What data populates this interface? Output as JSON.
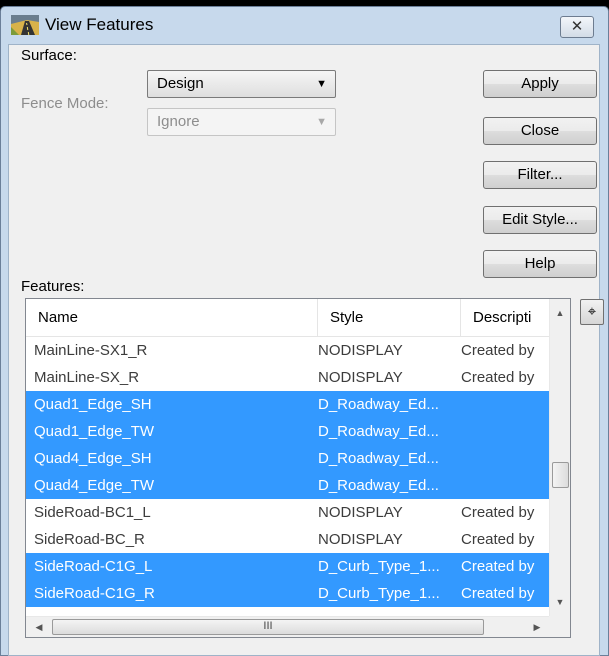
{
  "window": {
    "title": "View Features",
    "close_glyph": "✕"
  },
  "surface": {
    "label": "Surface:",
    "value": "Design"
  },
  "fence_mode": {
    "label": "Fence Mode:",
    "value": "Ignore"
  },
  "buttons": {
    "apply": "Apply",
    "close": "Close",
    "filter": "Filter...",
    "edit_style": "Edit Style...",
    "help": "Help"
  },
  "features": {
    "label": "Features:",
    "columns": [
      "Name",
      "Style",
      "Descripti"
    ],
    "rows": [
      {
        "name": "MainLine-SX1_R",
        "style": "NODISPLAY",
        "description": "Created by"
      },
      {
        "name": "MainLine-SX_R",
        "style": "NODISPLAY",
        "description": "Created by"
      },
      {
        "name": "Quad1_Edge_SH",
        "style": "D_Roadway_Ed...",
        "description": ""
      },
      {
        "name": "Quad1_Edge_TW",
        "style": "D_Roadway_Ed...",
        "description": ""
      },
      {
        "name": "Quad4_Edge_SH",
        "style": "D_Roadway_Ed...",
        "description": ""
      },
      {
        "name": "Quad4_Edge_TW",
        "style": "D_Roadway_Ed...",
        "description": ""
      },
      {
        "name": "SideRoad-BC1_L",
        "style": "NODISPLAY",
        "description": "Created by"
      },
      {
        "name": "SideRoad-BC_R",
        "style": "NODISPLAY",
        "description": "Created by"
      },
      {
        "name": "SideRoad-C1G_L",
        "style": "D_Curb_Type_1...",
        "description": "Created by"
      },
      {
        "name": "SideRoad-C1G_R",
        "style": "D_Curb_Type_1...",
        "description": "Created by"
      }
    ],
    "selected_rows": [
      2,
      3,
      4,
      5,
      8,
      9
    ],
    "hscroll_grip": "III"
  },
  "icons": {
    "app": "road-icon",
    "target": "crosshair-icon"
  },
  "colors": {
    "selection": "#3399ff",
    "title_bg": "#c7d9ec"
  }
}
